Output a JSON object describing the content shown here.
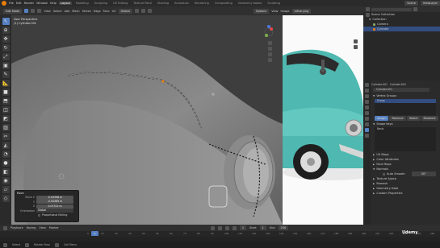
{
  "menu": [
    "File",
    "Edit",
    "Render",
    "Window",
    "Help"
  ],
  "workspaces": [
    "Layout",
    "Modeling",
    "Sculpting",
    "UV Editing",
    "Texture Paint",
    "Shading",
    "Animation",
    "Rendering",
    "Compositing",
    "Geometry Nodes",
    "Scripting"
  ],
  "active_workspace": "Layout",
  "scene": "Scene",
  "view_layer": "ViewLayer",
  "header": {
    "mode": "Edit Mode",
    "view": "View",
    "select": "Select",
    "add": "Add",
    "mesh": "Mesh",
    "vertex": "Vertex",
    "edge": "Edge",
    "face": "Face",
    "uv": "UV",
    "transform": "Global",
    "options": "Options",
    "ref_view": "View",
    "ref_image": "Image",
    "ref_file": "refcar.png"
  },
  "viewport": {
    "info_line1": "User Perspective",
    "info_line2": "(1) Cylinder.001"
  },
  "outliner": {
    "title": "Scene Collection",
    "items": [
      "Collection",
      "Camera",
      "Cylinder"
    ]
  },
  "properties": {
    "object_name": "Cylinder.001",
    "data_name": "Cylinder.001",
    "sections": [
      "Vertex Groups",
      "Shape Keys",
      "UV Maps",
      "Color Attributes",
      "Face Maps",
      "Normals",
      "Texture Space",
      "Remesh",
      "Geometry Data",
      "Custom Properties"
    ],
    "auto_smooth_label": "Auto Smooth",
    "auto_smooth_value": "30°",
    "group_name": "Group",
    "assign": "Assign",
    "remove": "Remove",
    "select": "Select",
    "deselect": "Deselect",
    "basis": "Basis"
  },
  "operator_panel": {
    "title": "Move",
    "move_label": "Move X",
    "y_label": "Y",
    "z_label": "Z",
    "x_value": "-0.04398 m",
    "y_value": "-0.04389 m",
    "z_value": "0.07312 m",
    "orientation_label": "Orientation",
    "orientation_value": "Global",
    "proportional": "Proportional Editing"
  },
  "timeline": {
    "playback": "Playback",
    "keying": "Keying",
    "view": "View",
    "marker": "Marker",
    "current_frame": "1",
    "start_label": "Start",
    "start": "1",
    "end_label": "End",
    "end": "250",
    "ticks": [
      "0",
      "10",
      "20",
      "30",
      "40",
      "50",
      "60",
      "70",
      "80",
      "90",
      "100",
      "110",
      "120",
      "130",
      "140",
      "150",
      "160",
      "170",
      "180",
      "190",
      "200",
      "210",
      "220",
      "230",
      "240",
      "250"
    ]
  },
  "status": {
    "select": "Select",
    "rotate": "Rotate View",
    "menu": "Call Menu"
  },
  "watermark": "Udemy",
  "colors": {
    "accent": "#5680c2",
    "selection": "#e87d0d",
    "car_body": "#4fb8b0"
  }
}
